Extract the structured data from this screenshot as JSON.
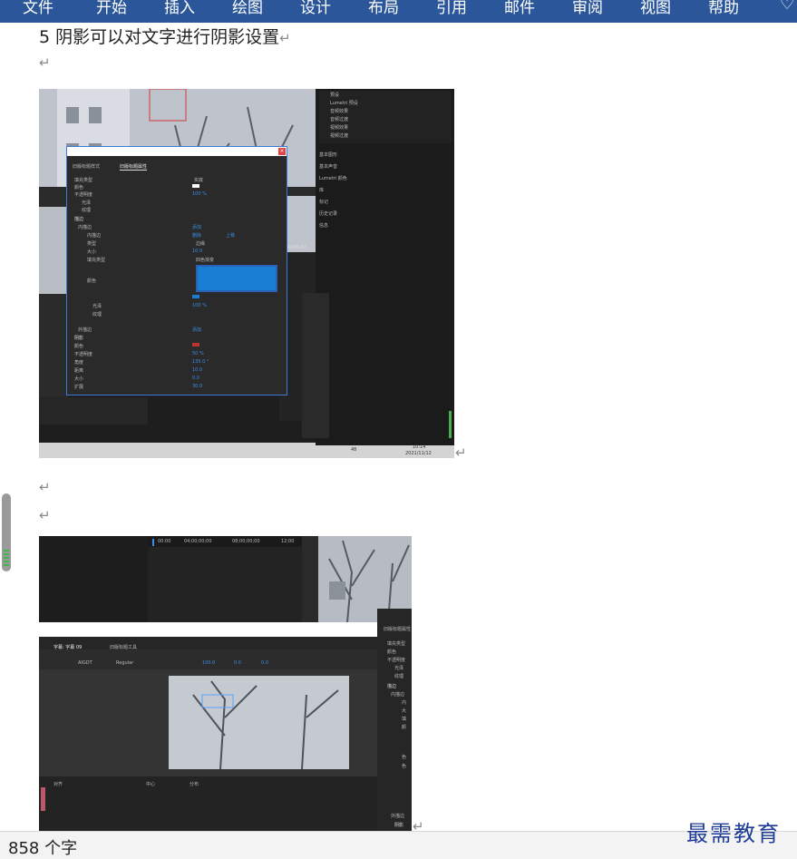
{
  "ribbon": {
    "tabs": [
      "文件",
      "开始",
      "插入",
      "绘图",
      "设计",
      "布局",
      "引用",
      "邮件",
      "审阅",
      "视图",
      "帮助"
    ]
  },
  "document": {
    "heading": "5 阴影可以对文字进行阴影设置",
    "pilcrow": "↵"
  },
  "screenshot1": {
    "panel_tabs": [
      "旧版标题样式",
      "旧版标题属性"
    ],
    "right_panel_items": [
      "预设",
      "Lumetri 预设",
      "音频效果",
      "音频过渡",
      "视频效果",
      "视频过渡"
    ],
    "right_panel_sections": [
      "基本图形",
      "基本声音",
      "Lumetri 颜色",
      "库",
      "标记",
      "历史记录",
      "信息"
    ],
    "props": [
      "填充类型",
      "颜色",
      "不透明度",
      "光泽",
      "纹理",
      "描边",
      "内描边",
      "内描边",
      "类型",
      "大小",
      "填充类型",
      "颜色",
      "光泽",
      "纹理",
      "外描边",
      "阴影",
      "颜色",
      "不透明度",
      "角度",
      "距离",
      "大小",
      "扩展"
    ],
    "values": [
      "实底",
      "100 %",
      "添加",
      "删除",
      "上移",
      "边缘",
      "10.0",
      "四色渐变",
      "100 %",
      "添加",
      "50 %",
      "135.0 °",
      "10.0",
      "0.0",
      "30.0"
    ],
    "timecode": "00;08;02",
    "taskbar_time": "10:14",
    "taskbar_date": "2021/11/12",
    "taskbar_extra": "48"
  },
  "screenshot2": {
    "timeline_labels": [
      "00:00",
      "04;00;00;00",
      "08;00;00;00",
      "12;00"
    ],
    "title_tabs": [
      "字幕: 字幕 09",
      "旧版标题工具"
    ],
    "font_name": "AIGDT",
    "font_style": "Regular",
    "font_size": "100.0",
    "kerning": "0.0",
    "leading": "0.0",
    "bottom_labels": [
      "对齐",
      "中心",
      "分布"
    ],
    "right_props": [
      "填充类型",
      "颜色",
      "不透明度",
      "光泽",
      "纹理",
      "描边",
      "内描边",
      "内",
      "大",
      "填",
      "颜",
      "色",
      "色",
      "外描边",
      "阴影"
    ],
    "right_panel_title": "旧版标题属性"
  },
  "status_bar": {
    "word_count": "858 个字"
  },
  "watermark": "最需教育",
  "colors": {
    "ribbon": "#2b579a",
    "accent_blue": "#1a7fd4",
    "dark_bg": "#1e1e1e"
  }
}
